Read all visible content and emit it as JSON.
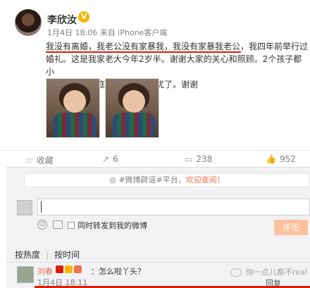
{
  "post": {
    "author": "李欣汝",
    "vip_badge": "V",
    "meta": "1月4日 18:06 来自 iPhone客户端",
    "content_line1": "我没有离婚，我老公没有家暴我，我没有家暴我老公，我四年前举行过",
    "content_line2": "婚礼。这是我家老大今年2岁半。谢谢大家的关心和照顾。2个孩子都小",
    "content_line3": "之前重心在家庭。让你们多担忧了。谢谢"
  },
  "actions": {
    "collect": "收藏",
    "forward": "6",
    "comment": "238",
    "like": "952"
  },
  "comment_panel": {
    "notice_prefix": "#微博辟谣#平台，",
    "notice_link": "欢迎查阅！",
    "forward_label": "同时转发到我的微博",
    "submit": "评论",
    "sort_hot": "按热度",
    "sort_time": "按时间"
  },
  "comments": [
    {
      "name": "刘春",
      "text": "：怎么啦丫头？",
      "time": "1月4日 18:11",
      "reply": "回复"
    }
  ],
  "watermark": "你一点儿都不real",
  "colors": {
    "accent": "#eb7350",
    "red_annotation": "#d81e06",
    "vip": "#f7b500"
  },
  "icons": {
    "collect": "star-icon",
    "forward": "forward-icon",
    "comment": "comment-icon",
    "like": "thumb-up-icon"
  }
}
